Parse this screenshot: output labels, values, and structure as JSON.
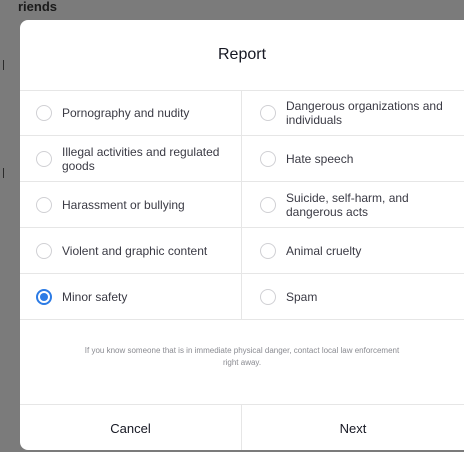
{
  "background": {
    "partial_text": "riends"
  },
  "dialog": {
    "title": "Report",
    "options": [
      [
        {
          "label": "Pornography and nudity",
          "checked": false
        },
        {
          "label": "Dangerous organizations and individuals",
          "checked": false
        }
      ],
      [
        {
          "label": "Illegal activities and regulated goods",
          "checked": false
        },
        {
          "label": "Hate speech",
          "checked": false
        }
      ],
      [
        {
          "label": "Harassment or bullying",
          "checked": false
        },
        {
          "label": "Suicide, self-harm, and dangerous acts",
          "checked": false
        }
      ],
      [
        {
          "label": "Violent and graphic content",
          "checked": false
        },
        {
          "label": "Animal cruelty",
          "checked": false
        }
      ],
      [
        {
          "label": "Minor safety",
          "checked": true
        },
        {
          "label": "Spam",
          "checked": false
        }
      ]
    ],
    "note": "If you know someone that is in immediate physical danger, contact local law enforcement right away.",
    "cancel_label": "Cancel",
    "next_label": "Next"
  },
  "colors": {
    "accent": "#2c7be5",
    "overlay": "#7b7b7b",
    "divider": "#e6e6e6"
  }
}
